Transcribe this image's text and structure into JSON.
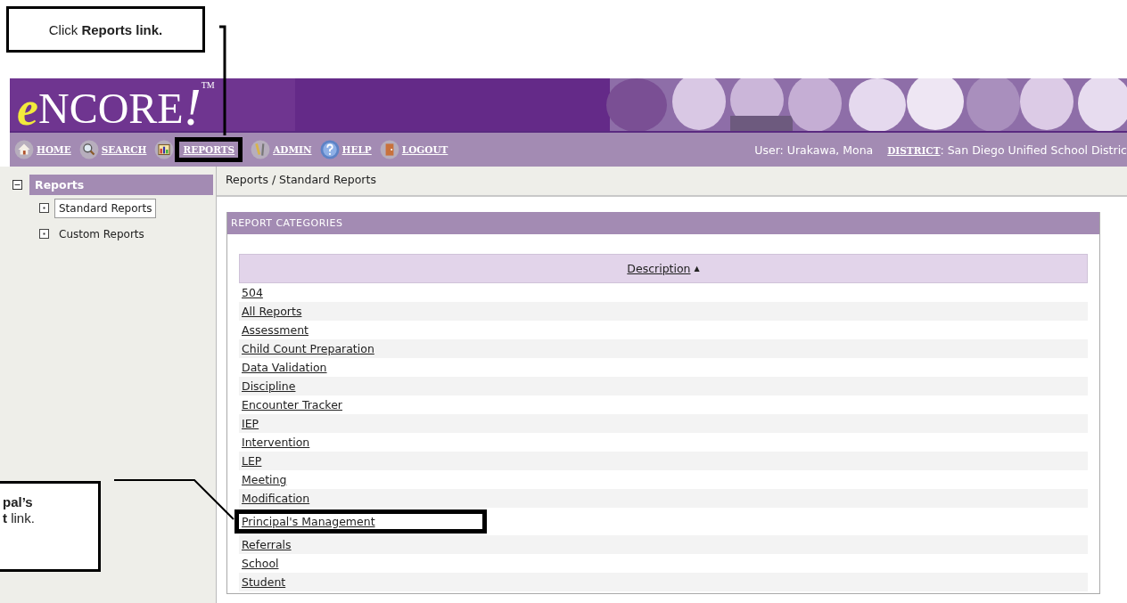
{
  "callouts": [
    {
      "lines": [
        "Click **Reports link.**"
      ]
    },
    {
      "lines": [
        "**pal’s**",
        "**t** link."
      ]
    }
  ],
  "logo": {
    "initial": "e",
    "name": "NCORE",
    "mark": "!",
    "tm": "TM"
  },
  "nav": [
    {
      "label": "HOME",
      "highlighted": false
    },
    {
      "label": "SEARCH",
      "highlighted": false
    },
    {
      "label": "REPORTS",
      "highlighted": true
    },
    {
      "label": "ADMIN",
      "highlighted": false
    },
    {
      "label": "HELP",
      "highlighted": false
    },
    {
      "label": "LOGOUT",
      "highlighted": false
    }
  ],
  "user": {
    "text": "User: Urakawa, Mona",
    "district_label": "DISTRICT",
    "district": ": San Diego Unified School Distric"
  },
  "sidebar": {
    "title": "Reports",
    "expanded": true,
    "items": [
      {
        "label": "Standard Reports",
        "selected": true
      },
      {
        "label": "Custom Reports",
        "selected": false
      }
    ]
  },
  "breadcrumb": "Reports / Standard Reports",
  "panel": {
    "title": "REPORT CATEGORIES",
    "column": "Description",
    "sort": "▲",
    "rows": [
      {
        "label": "504",
        "highlighted": false
      },
      {
        "label": "All Reports",
        "highlighted": false
      },
      {
        "label": "Assessment",
        "highlighted": false
      },
      {
        "label": "Child Count Preparation",
        "highlighted": false
      },
      {
        "label": "Data Validation",
        "highlighted": false
      },
      {
        "label": "Discipline",
        "highlighted": false
      },
      {
        "label": "Encounter Tracker",
        "highlighted": false
      },
      {
        "label": "IEP",
        "highlighted": false
      },
      {
        "label": "Intervention",
        "highlighted": false
      },
      {
        "label": "LEP",
        "highlighted": false
      },
      {
        "label": "Meeting",
        "highlighted": false
      },
      {
        "label": "Modification",
        "highlighted": false
      },
      {
        "label": "Principal's Management",
        "highlighted": true
      },
      {
        "label": "Referrals",
        "highlighted": false
      },
      {
        "label": "School",
        "highlighted": false
      },
      {
        "label": "Student",
        "highlighted": false
      }
    ]
  }
}
